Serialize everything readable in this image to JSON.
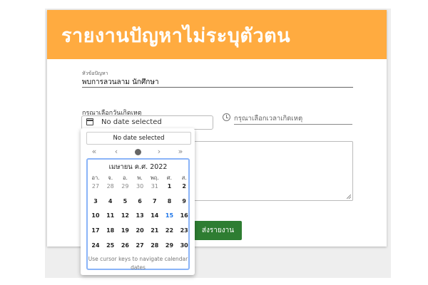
{
  "header": {
    "title": "รายงานปัญหาไม่ระบุตัวตน"
  },
  "topic": {
    "label": "หัวข้อปัญหา",
    "value": "พบการลวนลาม นักศึกษา"
  },
  "date": {
    "label": "กรุณาเลือกวันเกิดเหตุ",
    "value": "No date selected"
  },
  "time": {
    "placeholder": "กรุณาเลือกเวลาเกิดเหตุ"
  },
  "submit_label": "ส่งรายงาน",
  "calendar": {
    "selected_text": "No date selected",
    "nav": {
      "prev_year": "«",
      "prev_month": "‹",
      "next_month": "›",
      "next_year": "»"
    },
    "month_title": "เมษายน ค.ศ. 2022",
    "weekdays": [
      "อา.",
      "จ.",
      "อ.",
      "พ.",
      "พฤ.",
      "ศ.",
      "ส."
    ],
    "weeks": [
      [
        "27",
        "28",
        "29",
        "30",
        "31",
        "1",
        "2"
      ],
      [
        "3",
        "4",
        "5",
        "6",
        "7",
        "8",
        "9"
      ],
      [
        "10",
        "11",
        "12",
        "13",
        "14",
        "15",
        "16"
      ],
      [
        "17",
        "18",
        "19",
        "20",
        "21",
        "22",
        "23"
      ],
      [
        "24",
        "25",
        "26",
        "27",
        "28",
        "29",
        "30"
      ]
    ],
    "today": "15",
    "help": "Use cursor keys to navigate calendar dates"
  },
  "colors": {
    "header": "#ffab40",
    "submit": "#2e7d32",
    "today": "#1a73e8",
    "focus": "#8ab4f8"
  }
}
